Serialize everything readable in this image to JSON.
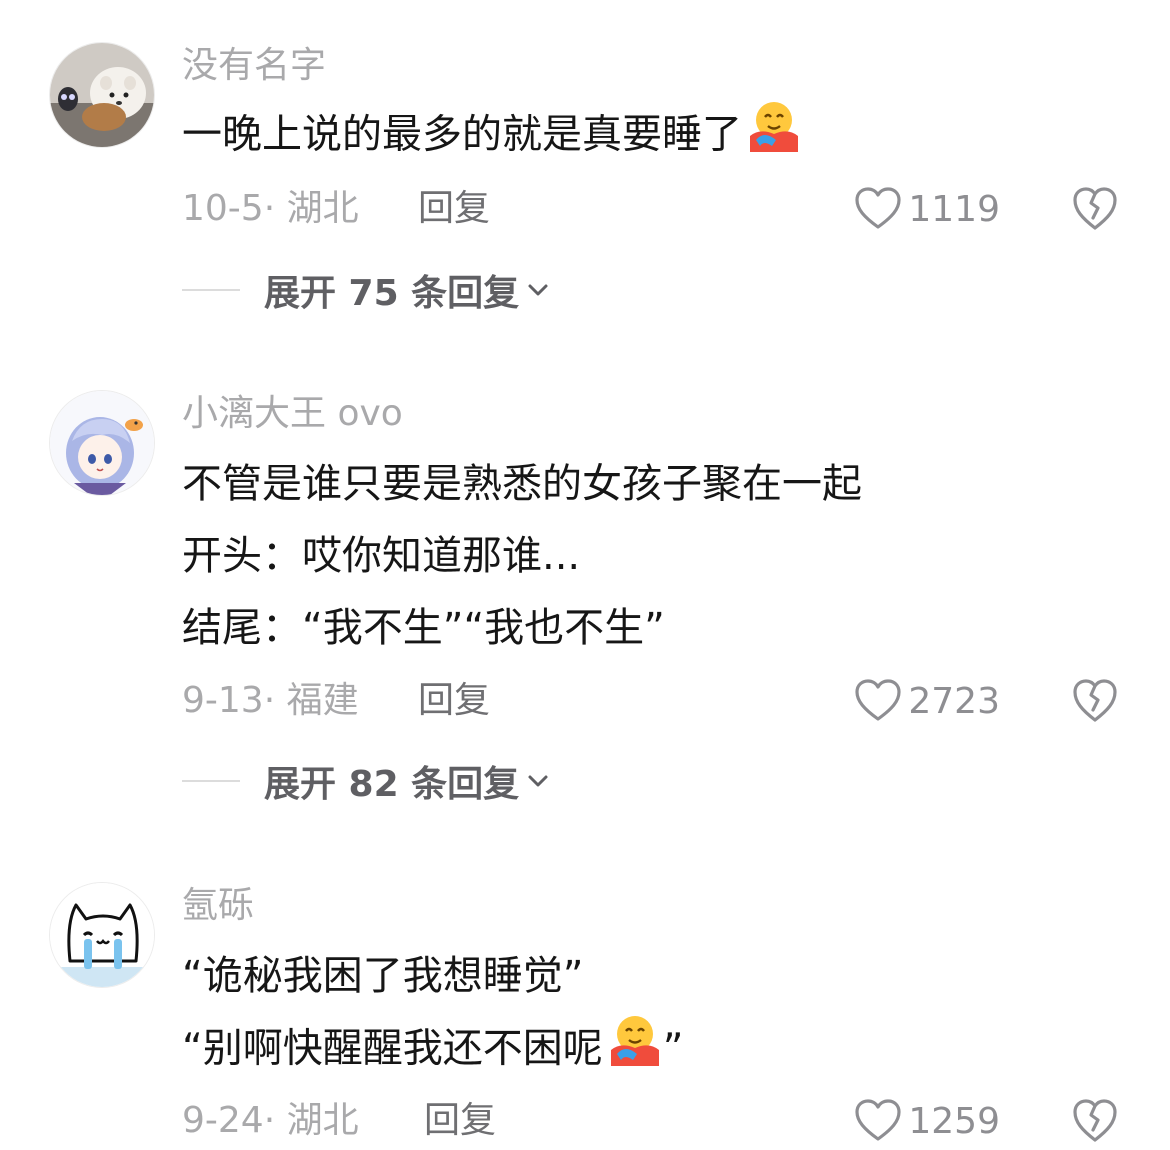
{
  "comments": [
    {
      "username": "没有名字",
      "avatar_icon": "dog-plush-photo",
      "lines": [
        "一晚上说的最多的就是真要睡了"
      ],
      "emoji": "hugging-face-emoji",
      "meta": "10-5· 湖北",
      "reply_label": "回复",
      "likes": "1119",
      "expand_label": "展开 75 条回复"
    },
    {
      "username": "小漓大王 ovo",
      "avatar_icon": "anime-girl-avatar",
      "lines": [
        "不管是谁只要是熟悉的女孩子聚在一起",
        "开头：哎你知道那谁...",
        "结尾：“我不生”“我也不生”"
      ],
      "meta": "9-13· 福建",
      "reply_label": "回复",
      "likes": "2723",
      "expand_label": "展开 82 条回复"
    },
    {
      "username": "氬砾",
      "avatar_icon": "crying-cat-avatar",
      "lines": [
        "“诡秘我困了我想睡觉”",
        "“别啊快醒醒我还不困呢"
      ],
      "line2_suffix": "”",
      "emoji": "hugging-face-emoji",
      "meta": "9-24· 湖北",
      "reply_label": "回复",
      "likes": "1259"
    }
  ],
  "colors": {
    "text": "#161616",
    "muted": "#a9a9ab",
    "reply": "#6f6f72",
    "icon": "#8e8e92"
  },
  "icons": {
    "like": "heart-outline-icon",
    "dislike": "broken-heart-icon",
    "expand": "chevron-down-icon"
  }
}
